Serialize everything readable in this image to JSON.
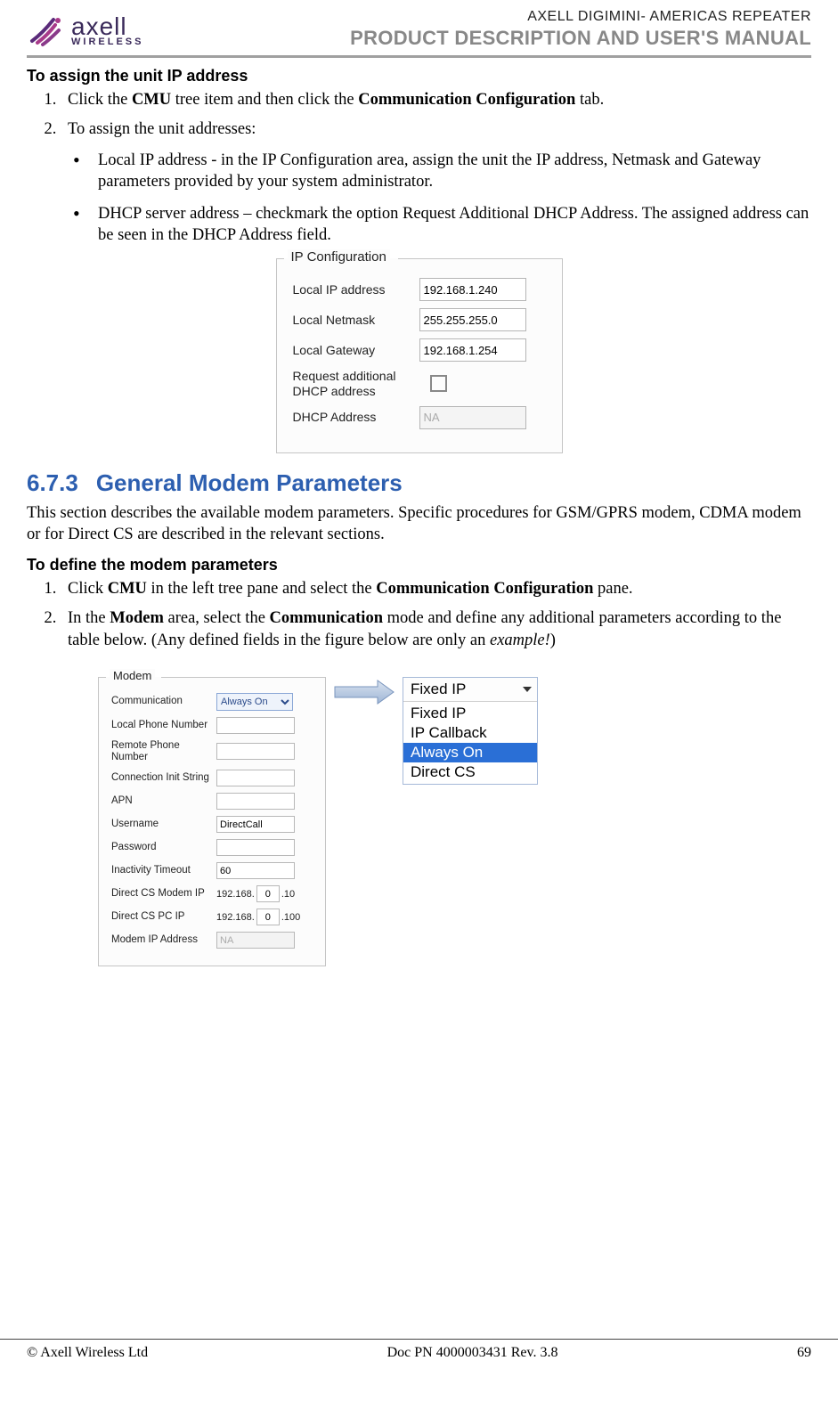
{
  "header": {
    "logo_brand_top": "axell",
    "logo_brand_bottom": "WIRELESS",
    "line1": "AXELL DIGIMINI- AMERICAS REPEATER",
    "line2": "PRODUCT DESCRIPTION AND USER'S MANUAL"
  },
  "section1": {
    "title": "To assign the unit IP address",
    "item1_pre": "Click the ",
    "item1_bold1": "CMU",
    "item1_mid": " tree item and then click the ",
    "item1_bold2": "Communication Configuration",
    "item1_post": " tab.",
    "item2": "To assign the unit addresses:",
    "bullet1": "Local IP address - in the IP Configuration area, assign the unit the IP address, Netmask and Gateway parameters provided by your system administrator.",
    "bullet2": "DHCP server address – checkmark the option Request Additional DHCP Address. The assigned address can be seen in the DHCP Address field."
  },
  "ipconfig": {
    "legend": "IP Configuration",
    "rows": {
      "ip_label": "Local IP address",
      "ip_val": "192.168.1.240",
      "nm_label": "Local Netmask",
      "nm_val": "255.255.255.0",
      "gw_label": "Local Gateway",
      "gw_val": "192.168.1.254",
      "req_label": "Request additional DHCP address",
      "dhcp_label": "DHCP Address",
      "dhcp_val": "NA"
    }
  },
  "h2": {
    "number": "6.7.3",
    "text": "General Modem Parameters"
  },
  "para1": "This section describes the available modem parameters. Specific procedures for GSM/GPRS modem, CDMA modem or for Direct CS are described in the relevant sections.",
  "section2": {
    "title": "To define the modem parameters",
    "item1_pre": " Click ",
    "item1_bold1": "CMU",
    "item1_mid": " in the left tree pane and select the ",
    "item1_bold2": "Communication Configuration",
    "item1_post": " pane.",
    "item2_pre": "In the ",
    "item2_bold1": "Modem",
    "item2_mid": " area, select the ",
    "item2_bold2": "Communication",
    "item2_mid2": " mode and define any additional parameters according to the table below. (Any defined fields in the figure below are only an ",
    "item2_em": "example!",
    "item2_post": ")"
  },
  "modem": {
    "legend": "Modem",
    "comm_label": "Communication",
    "comm_val": "Always On",
    "lpn_label": "Local Phone Number",
    "rpn_label": "Remote Phone Number",
    "cis_label": "Connection Init String",
    "apn_label": "APN",
    "user_label": "Username",
    "user_val": "DirectCall",
    "pw_label": "Password",
    "inact_label": "Inactivity Timeout",
    "inact_val": "60",
    "dcs_modem_label": "Direct CS Modem IP",
    "dcs_modem_prefix": "192.168.",
    "dcs_modem_octet": "0",
    "dcs_modem_suffix": ".10",
    "dcs_pc_label": "Direct CS PC IP",
    "dcs_pc_prefix": "192.168.",
    "dcs_pc_octet": "0",
    "dcs_pc_suffix": ".100",
    "mip_label": "Modem IP Address",
    "mip_val": "NA"
  },
  "dropdown": {
    "selected_display": "Fixed IP",
    "options": [
      "Fixed IP",
      "IP Callback",
      "Always On",
      "Direct CS"
    ],
    "highlighted_index": 2
  },
  "footer": {
    "left": "© Axell Wireless Ltd",
    "center": "Doc PN 4000003431 Rev. 3.8",
    "right": "69"
  }
}
